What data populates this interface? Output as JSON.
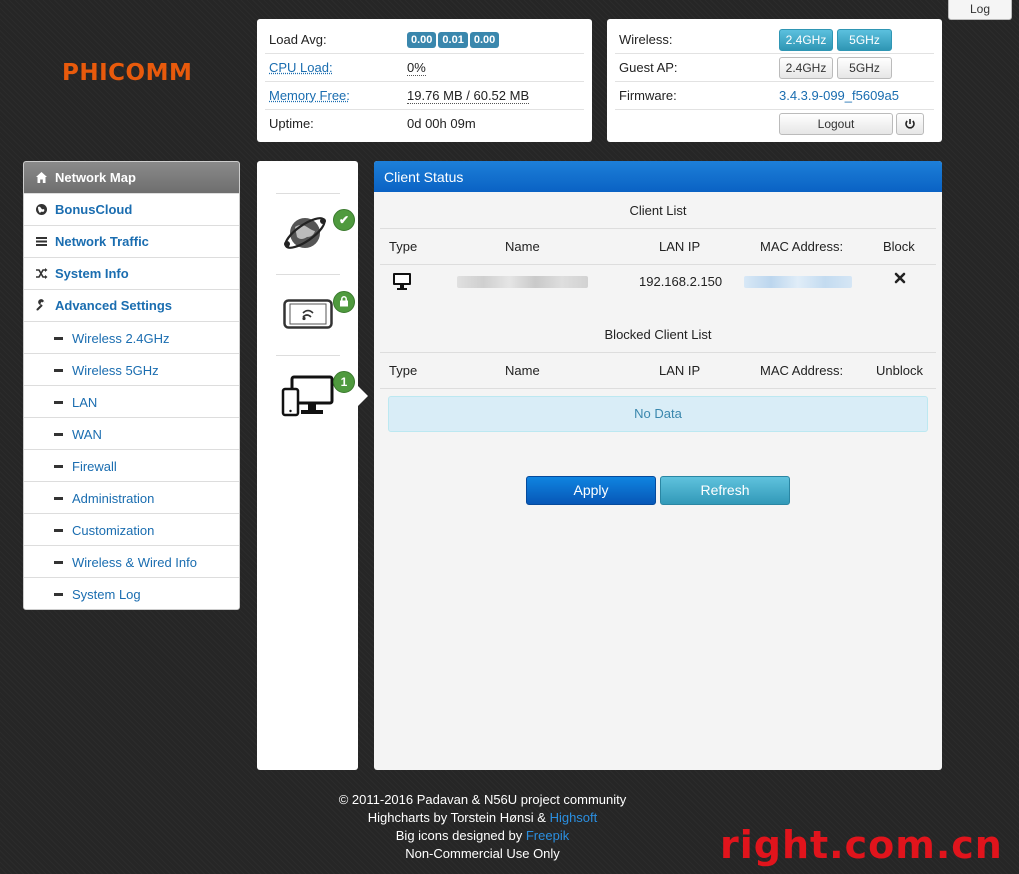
{
  "header": {
    "log_label": "Log",
    "brand": "PHICOMM"
  },
  "status_panel": {
    "load_avg_label": "Load Avg:",
    "load_avg_values": [
      "0.00",
      "0.01",
      "0.00"
    ],
    "cpu_label": "CPU Load:",
    "cpu_value": "0%",
    "memory_label": "Memory Free:",
    "memory_value": "19.76 MB / 60.52 MB",
    "uptime_label": "Uptime:",
    "uptime_value": "0d 00h 09m"
  },
  "wireless_panel": {
    "wireless_label": "Wireless:",
    "wireless_24": "2.4GHz",
    "wireless_5": "5GHz",
    "guest_label": "Guest AP:",
    "guest_24": "2.4GHz",
    "guest_5": "5GHz",
    "firmware_label": "Firmware:",
    "firmware_value": "3.4.3.9-099_f5609a5",
    "logout_label": "Logout",
    "power_icon": "power-icon"
  },
  "sidebar": {
    "items": [
      {
        "label": "Network Map",
        "icon": "home-icon"
      },
      {
        "label": "BonusCloud",
        "icon": "globe-icon"
      },
      {
        "label": "Network Traffic",
        "icon": "list-icon"
      },
      {
        "label": "System Info",
        "icon": "shuffle-icon"
      },
      {
        "label": "Advanced Settings",
        "icon": "wrench-icon"
      }
    ],
    "subitems": [
      "Wireless 2.4GHz",
      "Wireless 5GHz",
      "LAN",
      "WAN",
      "Firewall",
      "Administration",
      "Customization",
      "Wireless & Wired Info",
      "System Log"
    ]
  },
  "mid_icons": {
    "internet_icon": "globe-network-icon",
    "internet_status": "✔",
    "wireless_icon": "tablet-wifi-icon",
    "wireless_status": "lock-icon",
    "clients_icon": "devices-icon",
    "clients_count": "1"
  },
  "client_status": {
    "title": "Client Status",
    "client_list_title": "Client List",
    "columns": [
      "Type",
      "Name",
      "LAN IP",
      "MAC Address:",
      "Block"
    ],
    "clients": [
      {
        "type_icon": "desktop-icon",
        "lan_ip": "192.168.2.150",
        "block_icon": "close-icon"
      }
    ],
    "blocked_title": "Blocked Client List",
    "blocked_columns": [
      "Type",
      "Name",
      "LAN IP",
      "MAC Address:",
      "Unblock"
    ],
    "no_data": "No Data",
    "apply_label": "Apply",
    "refresh_label": "Refresh"
  },
  "footer": {
    "line1": "© 2011-2016 Padavan & N56U project community",
    "line2_prefix": "Highcharts by Torstein Hønsi & ",
    "line2_link": "Highsoft",
    "line3_prefix": "Big icons designed by ",
    "line3_link": "Freepik",
    "line4": "Non-Commercial Use Only"
  },
  "watermark": "right.com.cn",
  "colors": {
    "accent_blue": "#0a62c4",
    "badge_blue": "#3a87ad",
    "brand_orange": "#e85a0c",
    "status_green": "#4f9a3e",
    "watermark_red": "#e1141c"
  }
}
